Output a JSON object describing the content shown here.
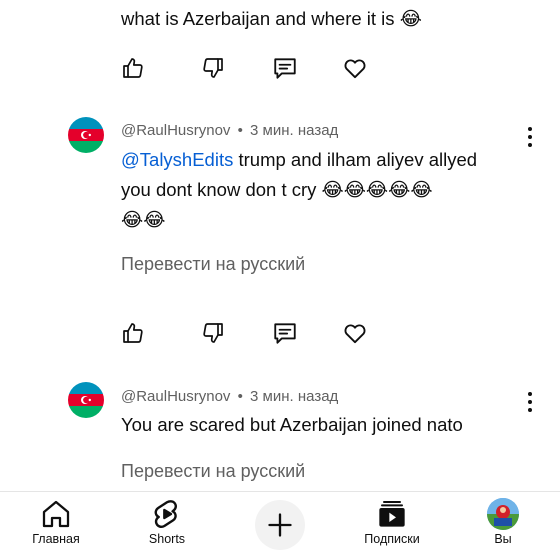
{
  "comments": [
    {
      "text": "what is Azerbaijan and where it is",
      "emoji": "😂"
    },
    {
      "author": "@RaulHusrynov",
      "time": "3 мин. назад",
      "mention": "@TalyshEdits",
      "line1": " trump and ilham aliyev allyed",
      "line2": "you dont know don t cry",
      "emoji_line2": "😂😂😂😂😂",
      "emoji_line3": "😂😂",
      "translate": "Перевести на русский"
    },
    {
      "author": "@RaulHusrynov",
      "time": "3 мин. назад",
      "text": "You are scared but Azerbaijan joined nato",
      "translate": "Перевести на русский"
    }
  ],
  "separator": "•",
  "nav": {
    "home": "Главная",
    "shorts": "Shorts",
    "subscriptions": "Подписки",
    "you": "Вы"
  },
  "colors": {
    "flag_blue": "#0092bc",
    "flag_red": "#e4002b",
    "flag_green": "#00af66",
    "link": "#065fd4",
    "secondary_text": "#606060"
  }
}
